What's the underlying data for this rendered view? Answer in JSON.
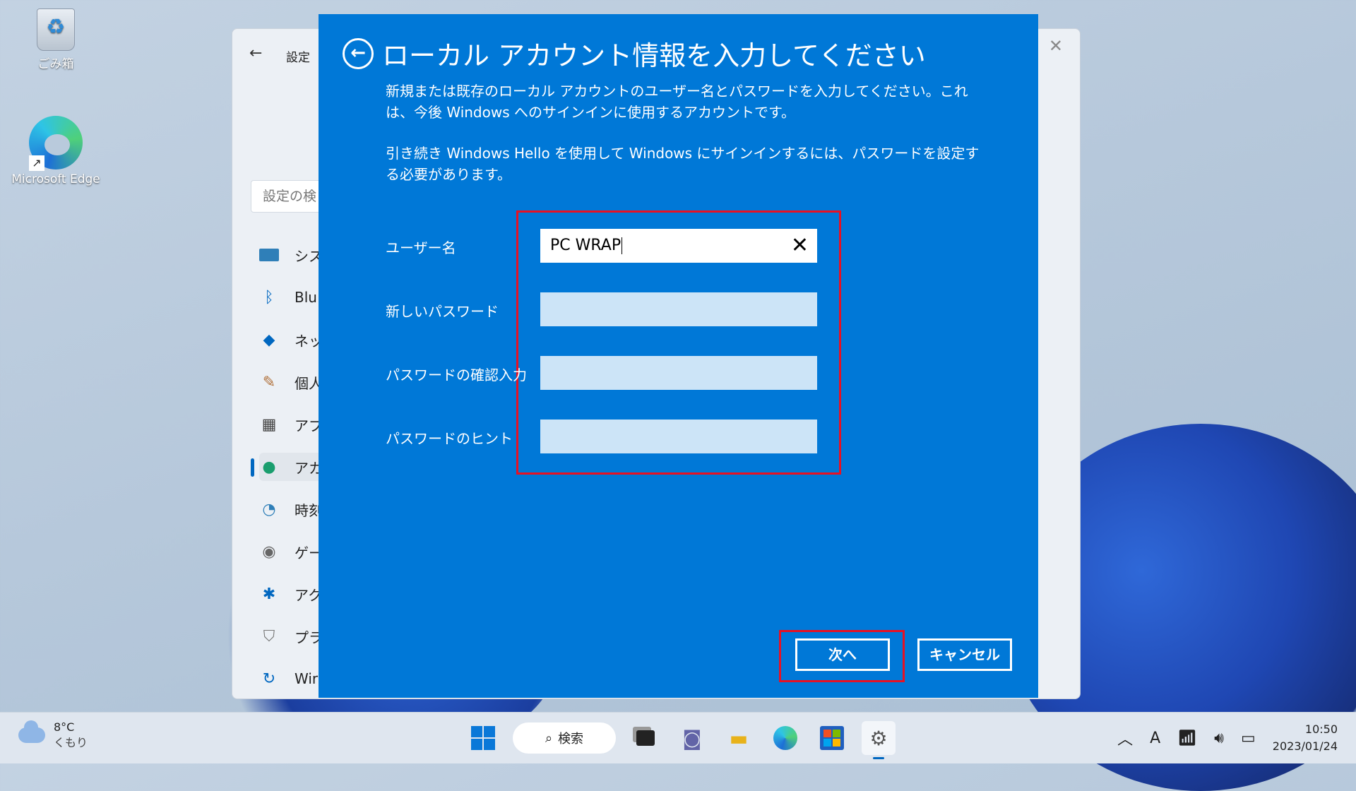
{
  "desktop": {
    "recycle_bin_label": "ごみ箱",
    "edge_label": "Microsoft Edge"
  },
  "settings_window": {
    "title": "設定",
    "search_placeholder": "設定の検",
    "nav": [
      {
        "label": "シス",
        "icon": "system-icon"
      },
      {
        "label": "Blu",
        "icon": "bluetooth-icon"
      },
      {
        "label": "ネッ",
        "icon": "network-icon"
      },
      {
        "label": "個人",
        "icon": "personalization-icon"
      },
      {
        "label": "アプ",
        "icon": "apps-icon"
      },
      {
        "label": "アカ",
        "icon": "accounts-icon"
      },
      {
        "label": "時刻",
        "icon": "time-icon"
      },
      {
        "label": "ゲー",
        "icon": "gaming-icon"
      },
      {
        "label": "アク",
        "icon": "accessibility-icon"
      },
      {
        "label": "プラ",
        "icon": "privacy-icon"
      },
      {
        "label": "Wir",
        "icon": "windows-update-icon"
      }
    ]
  },
  "dialog": {
    "title": "ローカル アカウント情報を入力してください",
    "paragraph1": "新規または既存のローカル アカウントのユーザー名とパスワードを入力してください。これは、今後 Windows へのサインインに使用するアカウントです。",
    "paragraph2": "引き続き Windows Hello を使用して Windows にサインインするには、パスワードを設定する必要があります。",
    "fields": {
      "username_label": "ユーザー名",
      "username_value": "PC WRAP",
      "new_password_label": "新しいパスワード",
      "confirm_password_label": "パスワードの確認入力",
      "hint_label": "パスワードのヒント"
    },
    "buttons": {
      "next": "次へ",
      "cancel": "キャンセル"
    },
    "highlight_color": "#e81123",
    "background_color": "#0078d7"
  },
  "taskbar": {
    "weather_temp": "8°C",
    "weather_status": "くもり",
    "search_label": "検索",
    "ime_indicator": "A",
    "time": "10:50",
    "date": "2023/01/24"
  }
}
